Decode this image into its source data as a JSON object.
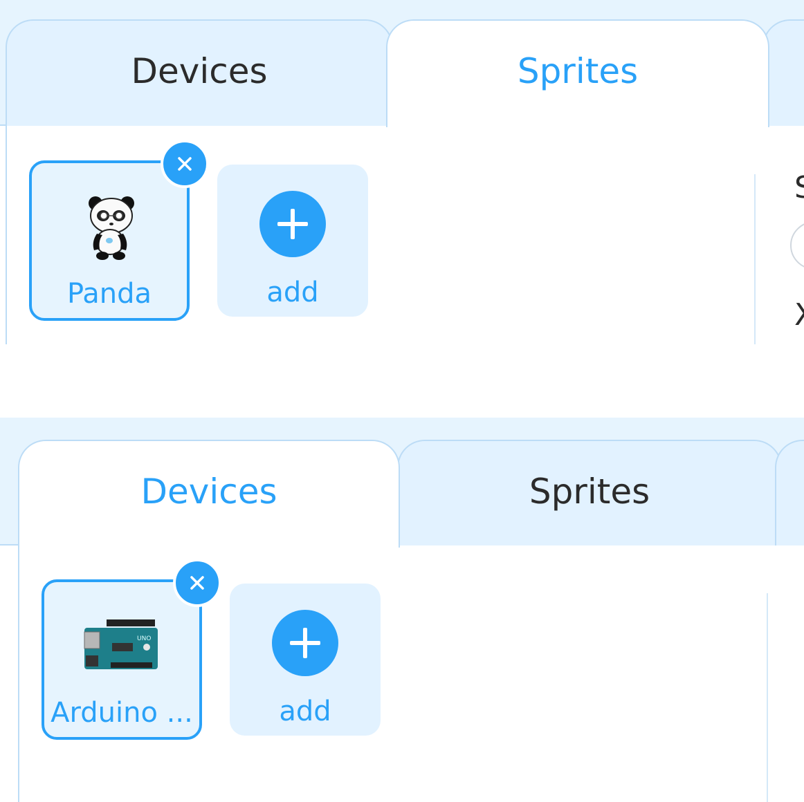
{
  "top_panel": {
    "tabs": [
      {
        "label": "Devices",
        "active": false
      },
      {
        "label": "Sprites",
        "active": true
      }
    ],
    "items": [
      {
        "label": "Panda",
        "icon": "panda-icon",
        "selected": true
      }
    ],
    "add_label": "add",
    "right_edge": {
      "label_1": "S",
      "label_2": "X"
    }
  },
  "bottom_panel": {
    "tabs": [
      {
        "label": "Devices",
        "active": true
      },
      {
        "label": "Sprites",
        "active": false
      }
    ],
    "items": [
      {
        "label": "Arduino ...",
        "icon": "arduino-board-icon",
        "selected": true
      }
    ],
    "add_label": "add"
  },
  "colors": {
    "accent": "#29a1f8",
    "tab_bg": "#e2f2ff",
    "border": "#bcdcf6"
  }
}
